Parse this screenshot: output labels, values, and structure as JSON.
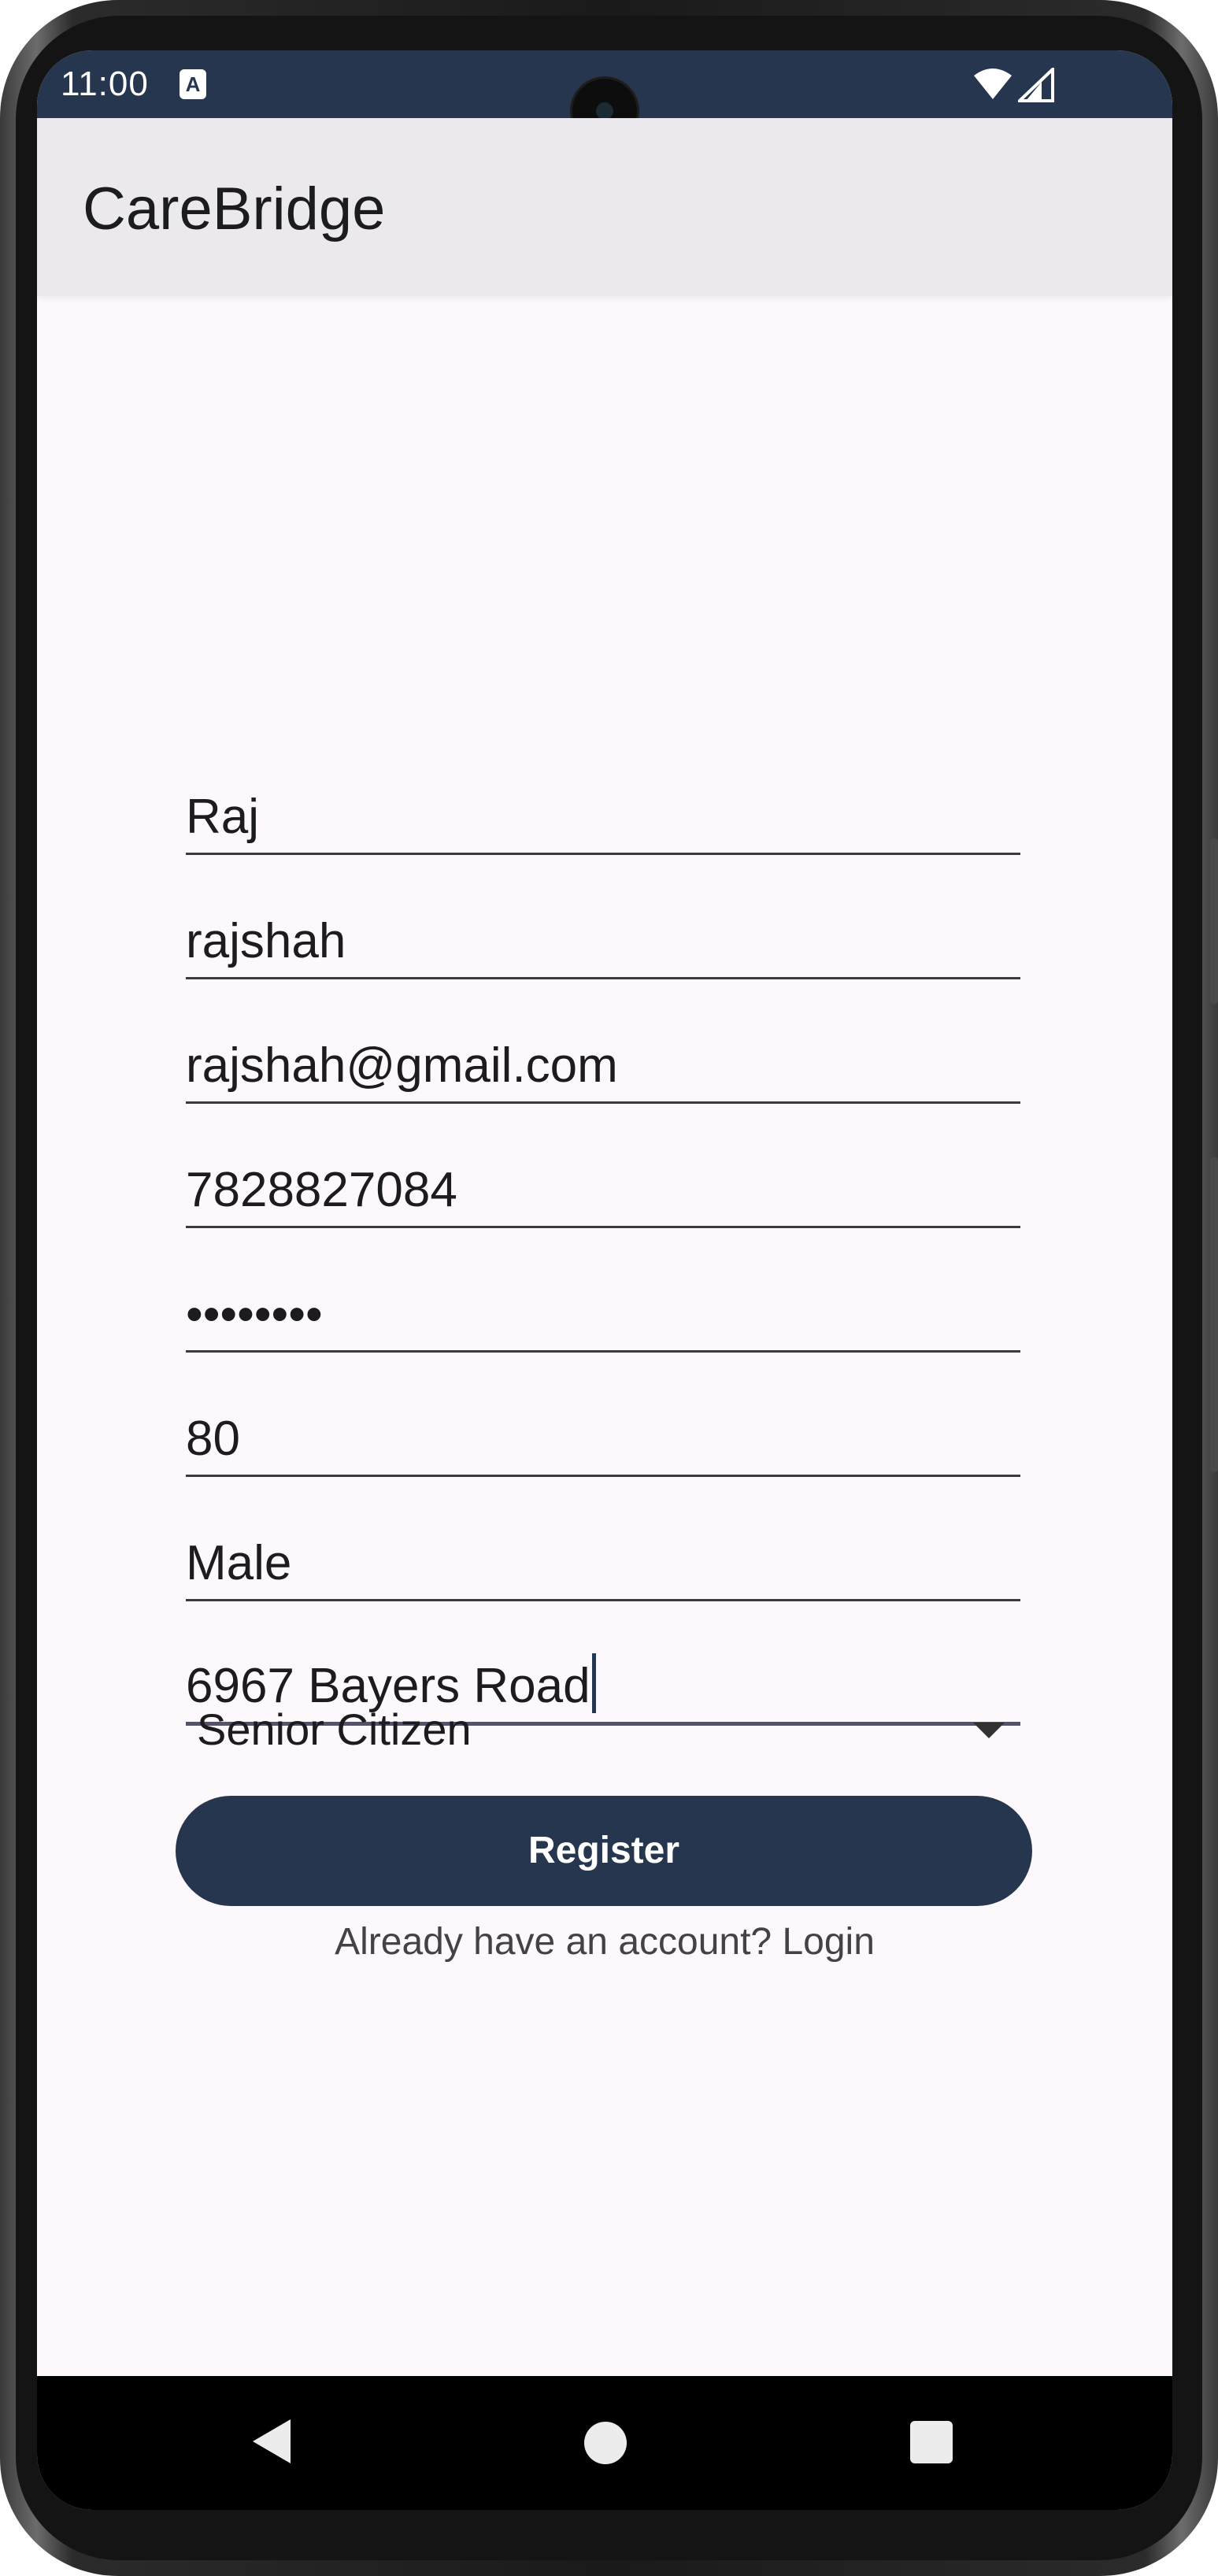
{
  "status_bar": {
    "time": "11:00",
    "notification_icon": "a-box-icon",
    "wifi_icon": "wifi-icon",
    "signal_icon": "cell-signal-icon"
  },
  "app_bar": {
    "title": "CareBridge"
  },
  "form": {
    "fields": [
      {
        "name": "first-name-field",
        "value": "Raj"
      },
      {
        "name": "username-field",
        "value": "rajshah"
      },
      {
        "name": "email-field",
        "value": "rajshah@gmail.com"
      },
      {
        "name": "phone-field",
        "value": "7828827084"
      },
      {
        "name": "password-field",
        "value": "••••••••"
      },
      {
        "name": "age-field",
        "value": "80"
      },
      {
        "name": "gender-field",
        "value": "Male"
      },
      {
        "name": "address-field",
        "value": "6967 Bayers Road"
      }
    ],
    "role_dropdown": {
      "selected": "Senior Citizen",
      "icon": "dropdown-arrow-icon"
    },
    "register_label": "Register",
    "login_link": "Already have an account? Login"
  },
  "nav_bar": {
    "back_icon": "back-icon",
    "home_icon": "home-icon",
    "recents_icon": "recents-icon"
  },
  "colors": {
    "primary": "#26364f",
    "background": "#fdf8fb",
    "app_bar": "#ebe9ed"
  }
}
